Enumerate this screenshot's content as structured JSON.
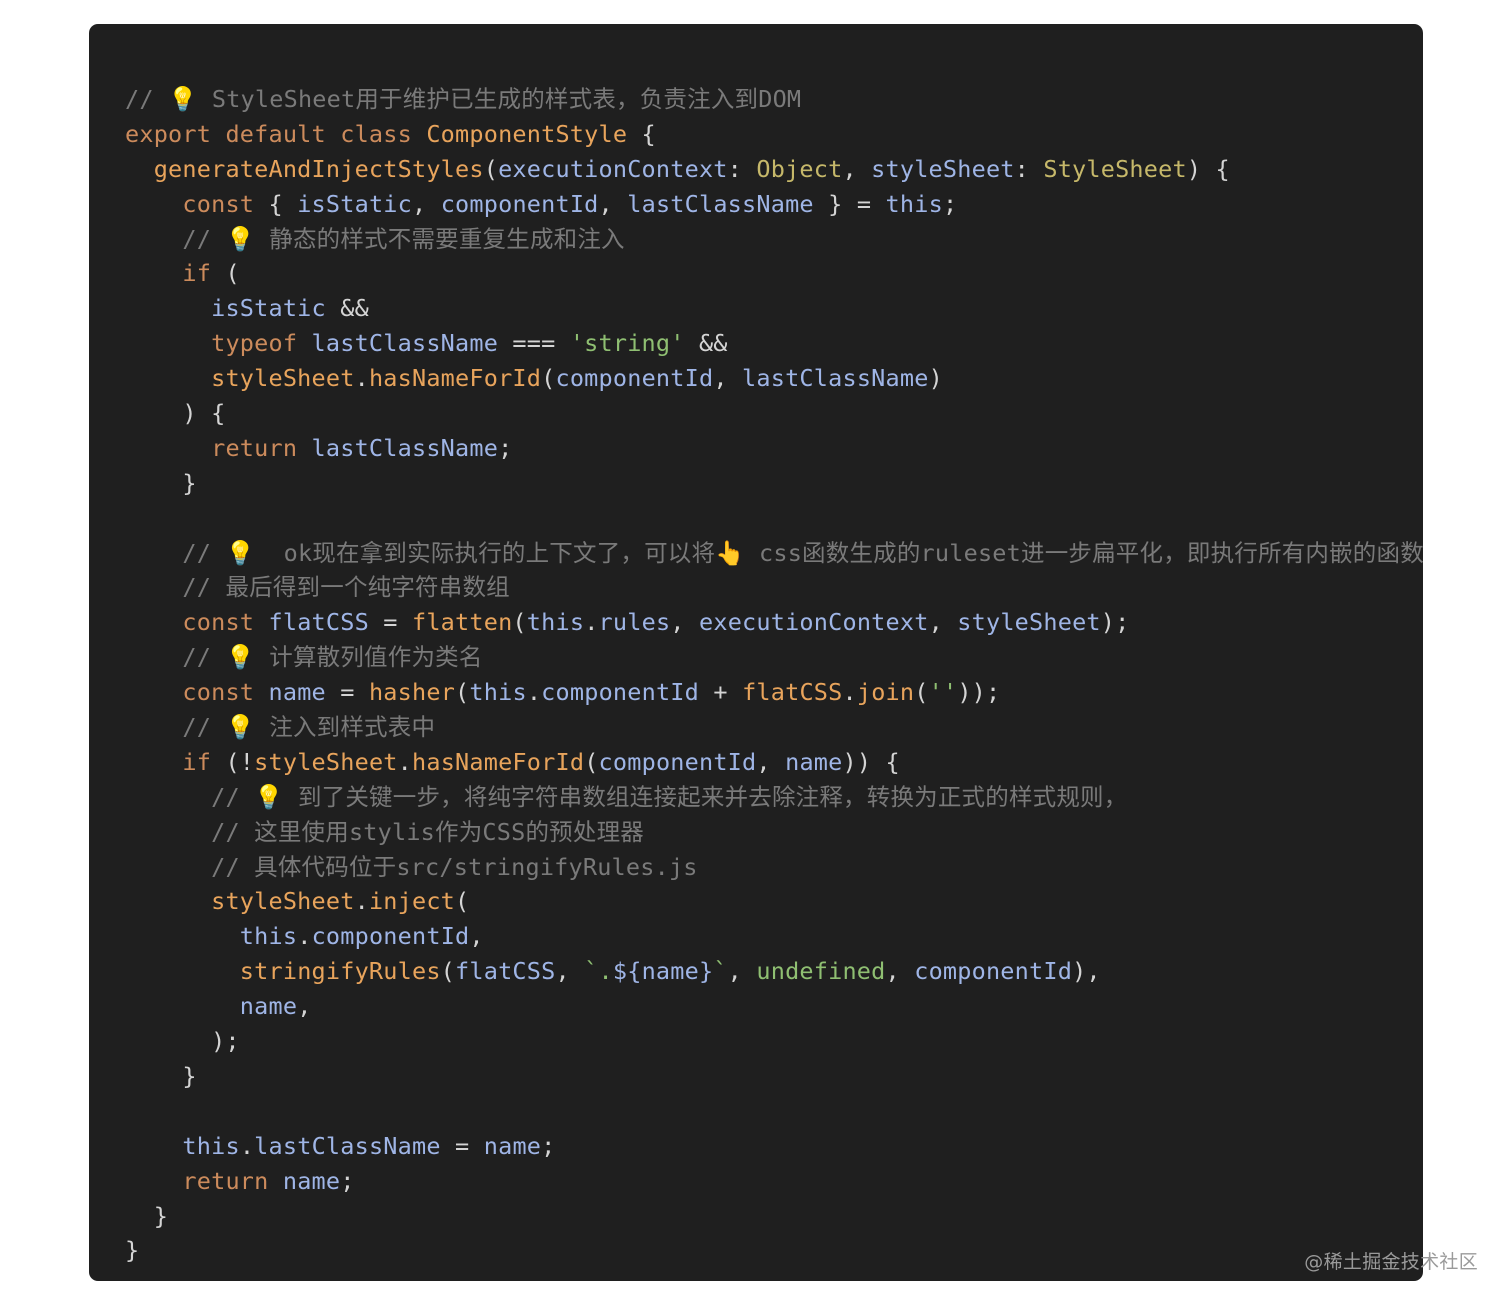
{
  "code": {
    "language": "javascript",
    "lines": [
      [
        {
          "t": "comment",
          "v": "// 💡 StyleSheet用于维护已生成的样式表，负责注入到DOM"
        }
      ],
      [
        {
          "t": "keyword",
          "v": "export "
        },
        {
          "t": "keyword",
          "v": "default "
        },
        {
          "t": "keyword",
          "v": "class "
        },
        {
          "t": "class",
          "v": "ComponentStyle"
        },
        {
          "t": "punct",
          "v": " {"
        }
      ],
      [
        {
          "t": "punct",
          "v": "  "
        },
        {
          "t": "func",
          "v": "generateAndInjectStyles"
        },
        {
          "t": "punct",
          "v": "("
        },
        {
          "t": "var",
          "v": "executionContext"
        },
        {
          "t": "punct",
          "v": ": "
        },
        {
          "t": "type",
          "v": "Object"
        },
        {
          "t": "punct",
          "v": ", "
        },
        {
          "t": "var",
          "v": "styleSheet"
        },
        {
          "t": "punct",
          "v": ": "
        },
        {
          "t": "type",
          "v": "StyleSheet"
        },
        {
          "t": "punct",
          "v": ") {"
        }
      ],
      [
        {
          "t": "punct",
          "v": "    "
        },
        {
          "t": "keyword",
          "v": "const "
        },
        {
          "t": "punct",
          "v": "{ "
        },
        {
          "t": "var",
          "v": "isStatic"
        },
        {
          "t": "punct",
          "v": ", "
        },
        {
          "t": "var",
          "v": "componentId"
        },
        {
          "t": "punct",
          "v": ", "
        },
        {
          "t": "var",
          "v": "lastClassName"
        },
        {
          "t": "punct",
          "v": " } = "
        },
        {
          "t": "this",
          "v": "this"
        },
        {
          "t": "punct",
          "v": ";"
        }
      ],
      [
        {
          "t": "punct",
          "v": "    "
        },
        {
          "t": "comment",
          "v": "// 💡 静态的样式不需要重复生成和注入"
        }
      ],
      [
        {
          "t": "punct",
          "v": "    "
        },
        {
          "t": "keyword",
          "v": "if"
        },
        {
          "t": "punct",
          "v": " ("
        }
      ],
      [
        {
          "t": "punct",
          "v": "      "
        },
        {
          "t": "var",
          "v": "isStatic"
        },
        {
          "t": "punct",
          "v": " &&"
        }
      ],
      [
        {
          "t": "punct",
          "v": "      "
        },
        {
          "t": "keyword",
          "v": "typeof "
        },
        {
          "t": "var",
          "v": "lastClassName"
        },
        {
          "t": "punct",
          "v": " === "
        },
        {
          "t": "string",
          "v": "'string'"
        },
        {
          "t": "punct",
          "v": " &&"
        }
      ],
      [
        {
          "t": "punct",
          "v": "      "
        },
        {
          "t": "func",
          "v": "styleSheet"
        },
        {
          "t": "punct",
          "v": "."
        },
        {
          "t": "func",
          "v": "hasNameForId"
        },
        {
          "t": "punct",
          "v": "("
        },
        {
          "t": "var",
          "v": "componentId"
        },
        {
          "t": "punct",
          "v": ", "
        },
        {
          "t": "var",
          "v": "lastClassName"
        },
        {
          "t": "punct",
          "v": ")"
        }
      ],
      [
        {
          "t": "punct",
          "v": "    ) {"
        }
      ],
      [
        {
          "t": "punct",
          "v": "      "
        },
        {
          "t": "keyword",
          "v": "return "
        },
        {
          "t": "var",
          "v": "lastClassName"
        },
        {
          "t": "punct",
          "v": ";"
        }
      ],
      [
        {
          "t": "punct",
          "v": "    }"
        }
      ],
      [
        {
          "t": "punct",
          "v": ""
        }
      ],
      [
        {
          "t": "punct",
          "v": "    "
        },
        {
          "t": "comment",
          "v": "// 💡  ok现在拿到实际执行的上下文了，可以将👆 css函数生成的ruleset进一步扁平化，即执行所有内嵌的函数，"
        }
      ],
      [
        {
          "t": "punct",
          "v": "    "
        },
        {
          "t": "comment",
          "v": "// 最后得到一个纯字符串数组"
        }
      ],
      [
        {
          "t": "punct",
          "v": "    "
        },
        {
          "t": "keyword",
          "v": "const "
        },
        {
          "t": "var",
          "v": "flatCSS"
        },
        {
          "t": "punct",
          "v": " = "
        },
        {
          "t": "func",
          "v": "flatten"
        },
        {
          "t": "punct",
          "v": "("
        },
        {
          "t": "this",
          "v": "this"
        },
        {
          "t": "punct",
          "v": "."
        },
        {
          "t": "prop",
          "v": "rules"
        },
        {
          "t": "punct",
          "v": ", "
        },
        {
          "t": "var",
          "v": "executionContext"
        },
        {
          "t": "punct",
          "v": ", "
        },
        {
          "t": "var",
          "v": "styleSheet"
        },
        {
          "t": "punct",
          "v": ");"
        }
      ],
      [
        {
          "t": "punct",
          "v": "    "
        },
        {
          "t": "comment",
          "v": "// 💡 计算散列值作为类名"
        }
      ],
      [
        {
          "t": "punct",
          "v": "    "
        },
        {
          "t": "keyword",
          "v": "const "
        },
        {
          "t": "var",
          "v": "name"
        },
        {
          "t": "punct",
          "v": " = "
        },
        {
          "t": "func",
          "v": "hasher"
        },
        {
          "t": "punct",
          "v": "("
        },
        {
          "t": "this",
          "v": "this"
        },
        {
          "t": "punct",
          "v": "."
        },
        {
          "t": "prop",
          "v": "componentId"
        },
        {
          "t": "punct",
          "v": " + "
        },
        {
          "t": "func",
          "v": "flatCSS"
        },
        {
          "t": "punct",
          "v": "."
        },
        {
          "t": "func",
          "v": "join"
        },
        {
          "t": "punct",
          "v": "("
        },
        {
          "t": "string",
          "v": "''"
        },
        {
          "t": "punct",
          "v": "));"
        }
      ],
      [
        {
          "t": "punct",
          "v": "    "
        },
        {
          "t": "comment",
          "v": "// 💡 注入到样式表中"
        }
      ],
      [
        {
          "t": "punct",
          "v": "    "
        },
        {
          "t": "keyword",
          "v": "if"
        },
        {
          "t": "punct",
          "v": " (!"
        },
        {
          "t": "func",
          "v": "styleSheet"
        },
        {
          "t": "punct",
          "v": "."
        },
        {
          "t": "func",
          "v": "hasNameForId"
        },
        {
          "t": "punct",
          "v": "("
        },
        {
          "t": "var",
          "v": "componentId"
        },
        {
          "t": "punct",
          "v": ", "
        },
        {
          "t": "var",
          "v": "name"
        },
        {
          "t": "punct",
          "v": ")) {"
        }
      ],
      [
        {
          "t": "punct",
          "v": "      "
        },
        {
          "t": "comment",
          "v": "// 💡 到了关键一步，将纯字符串数组连接起来并去除注释，转换为正式的样式规则，"
        }
      ],
      [
        {
          "t": "punct",
          "v": "      "
        },
        {
          "t": "comment",
          "v": "// 这里使用stylis作为CSS的预处理器"
        }
      ],
      [
        {
          "t": "punct",
          "v": "      "
        },
        {
          "t": "comment",
          "v": "// 具体代码位于src/stringifyRules.js"
        }
      ],
      [
        {
          "t": "punct",
          "v": "      "
        },
        {
          "t": "func",
          "v": "styleSheet"
        },
        {
          "t": "punct",
          "v": "."
        },
        {
          "t": "func",
          "v": "inject"
        },
        {
          "t": "punct",
          "v": "("
        }
      ],
      [
        {
          "t": "punct",
          "v": "        "
        },
        {
          "t": "this",
          "v": "this"
        },
        {
          "t": "punct",
          "v": "."
        },
        {
          "t": "prop",
          "v": "componentId"
        },
        {
          "t": "punct",
          "v": ","
        }
      ],
      [
        {
          "t": "punct",
          "v": "        "
        },
        {
          "t": "func",
          "v": "stringifyRules"
        },
        {
          "t": "punct",
          "v": "("
        },
        {
          "t": "var",
          "v": "flatCSS"
        },
        {
          "t": "punct",
          "v": ", "
        },
        {
          "t": "string",
          "v": "`."
        },
        {
          "t": "tpl",
          "v": "${name}"
        },
        {
          "t": "string",
          "v": "`"
        },
        {
          "t": "punct",
          "v": ", "
        },
        {
          "t": "undef",
          "v": "undefined"
        },
        {
          "t": "punct",
          "v": ", "
        },
        {
          "t": "var",
          "v": "componentId"
        },
        {
          "t": "punct",
          "v": "),"
        }
      ],
      [
        {
          "t": "punct",
          "v": "        "
        },
        {
          "t": "var",
          "v": "name"
        },
        {
          "t": "punct",
          "v": ","
        }
      ],
      [
        {
          "t": "punct",
          "v": "      );"
        }
      ],
      [
        {
          "t": "punct",
          "v": "    }"
        }
      ],
      [
        {
          "t": "punct",
          "v": ""
        }
      ],
      [
        {
          "t": "punct",
          "v": "    "
        },
        {
          "t": "this",
          "v": "this"
        },
        {
          "t": "punct",
          "v": "."
        },
        {
          "t": "prop",
          "v": "lastClassName"
        },
        {
          "t": "punct",
          "v": " = "
        },
        {
          "t": "var",
          "v": "name"
        },
        {
          "t": "punct",
          "v": ";"
        }
      ],
      [
        {
          "t": "punct",
          "v": "    "
        },
        {
          "t": "keyword",
          "v": "return "
        },
        {
          "t": "var",
          "v": "name"
        },
        {
          "t": "punct",
          "v": ";"
        }
      ],
      [
        {
          "t": "punct",
          "v": "  }"
        }
      ],
      [
        {
          "t": "punct",
          "v": "}"
        }
      ]
    ]
  },
  "watermark": "@稀土掘金技术社区",
  "colors": {
    "background": "#1f1f1f",
    "comment": "#7a7a7a",
    "keyword": "#cc8b5c",
    "function": "#e8a45c",
    "variable": "#9fb5e6",
    "string": "#8fbf72",
    "type": "#c6b86a"
  }
}
